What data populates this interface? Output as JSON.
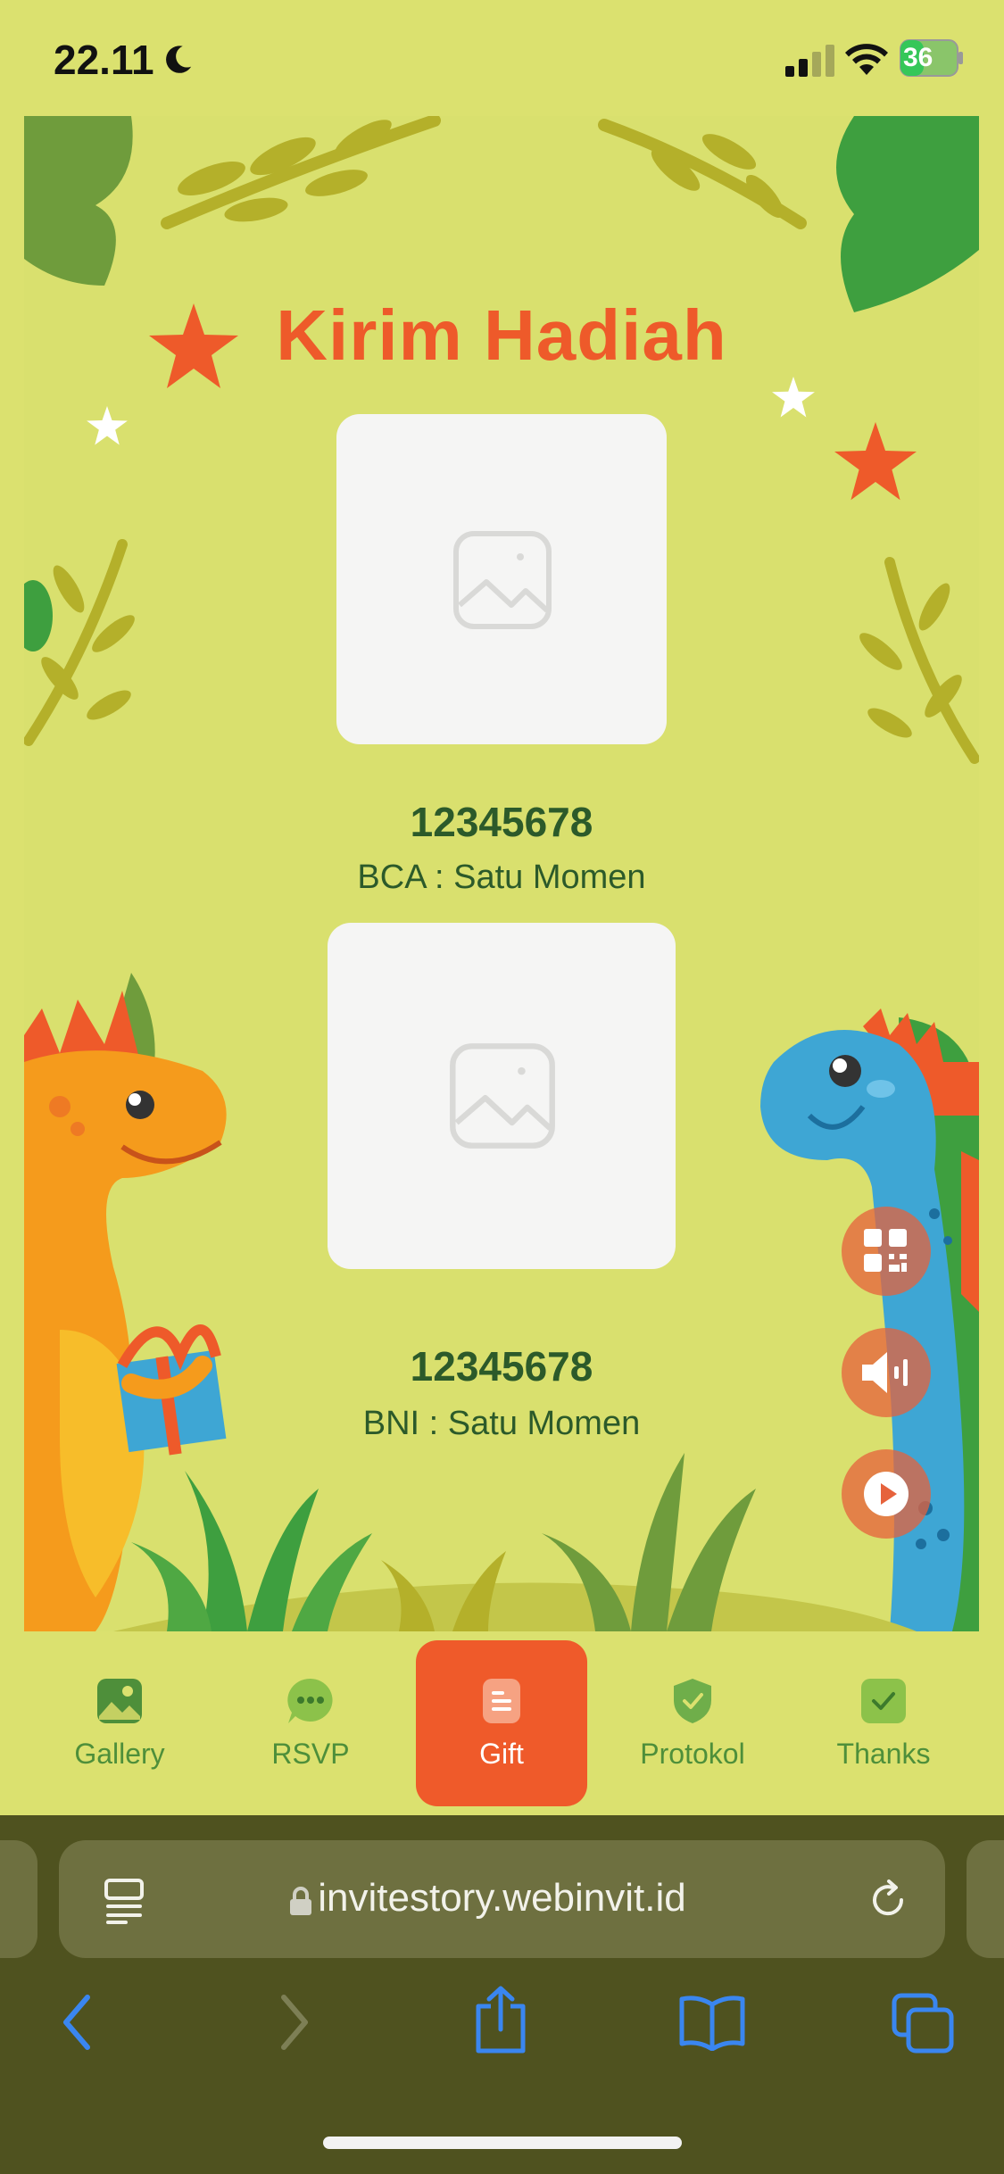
{
  "status_bar": {
    "time": "22.11",
    "battery": "36"
  },
  "gift_section": {
    "title": "Kirim Hadiah",
    "accounts": [
      {
        "number": "12345678",
        "name": "BCA : Satu Momen"
      },
      {
        "number": "12345678",
        "name": "BNI : Satu Momen"
      }
    ]
  },
  "floating_buttons": {
    "qr": "qr-code-icon",
    "sound": "speaker-icon",
    "play": "play-icon"
  },
  "tab_bar": {
    "items": [
      {
        "label": "Gallery",
        "icon": "image-icon",
        "active": false
      },
      {
        "label": "RSVP",
        "icon": "chat-icon",
        "active": false
      },
      {
        "label": "Gift",
        "icon": "gift-list-icon",
        "active": true
      },
      {
        "label": "Protokol",
        "icon": "shield-check-icon",
        "active": false
      },
      {
        "label": "Thanks",
        "icon": "check-badge-icon",
        "active": false
      }
    ]
  },
  "browser": {
    "url": "invitestory.webinvit.id"
  },
  "colors": {
    "background": "#dbe16f",
    "accent": "#ee5a2a",
    "text_green": "#2c5a2a",
    "tab_green": "#4e8f3a"
  }
}
